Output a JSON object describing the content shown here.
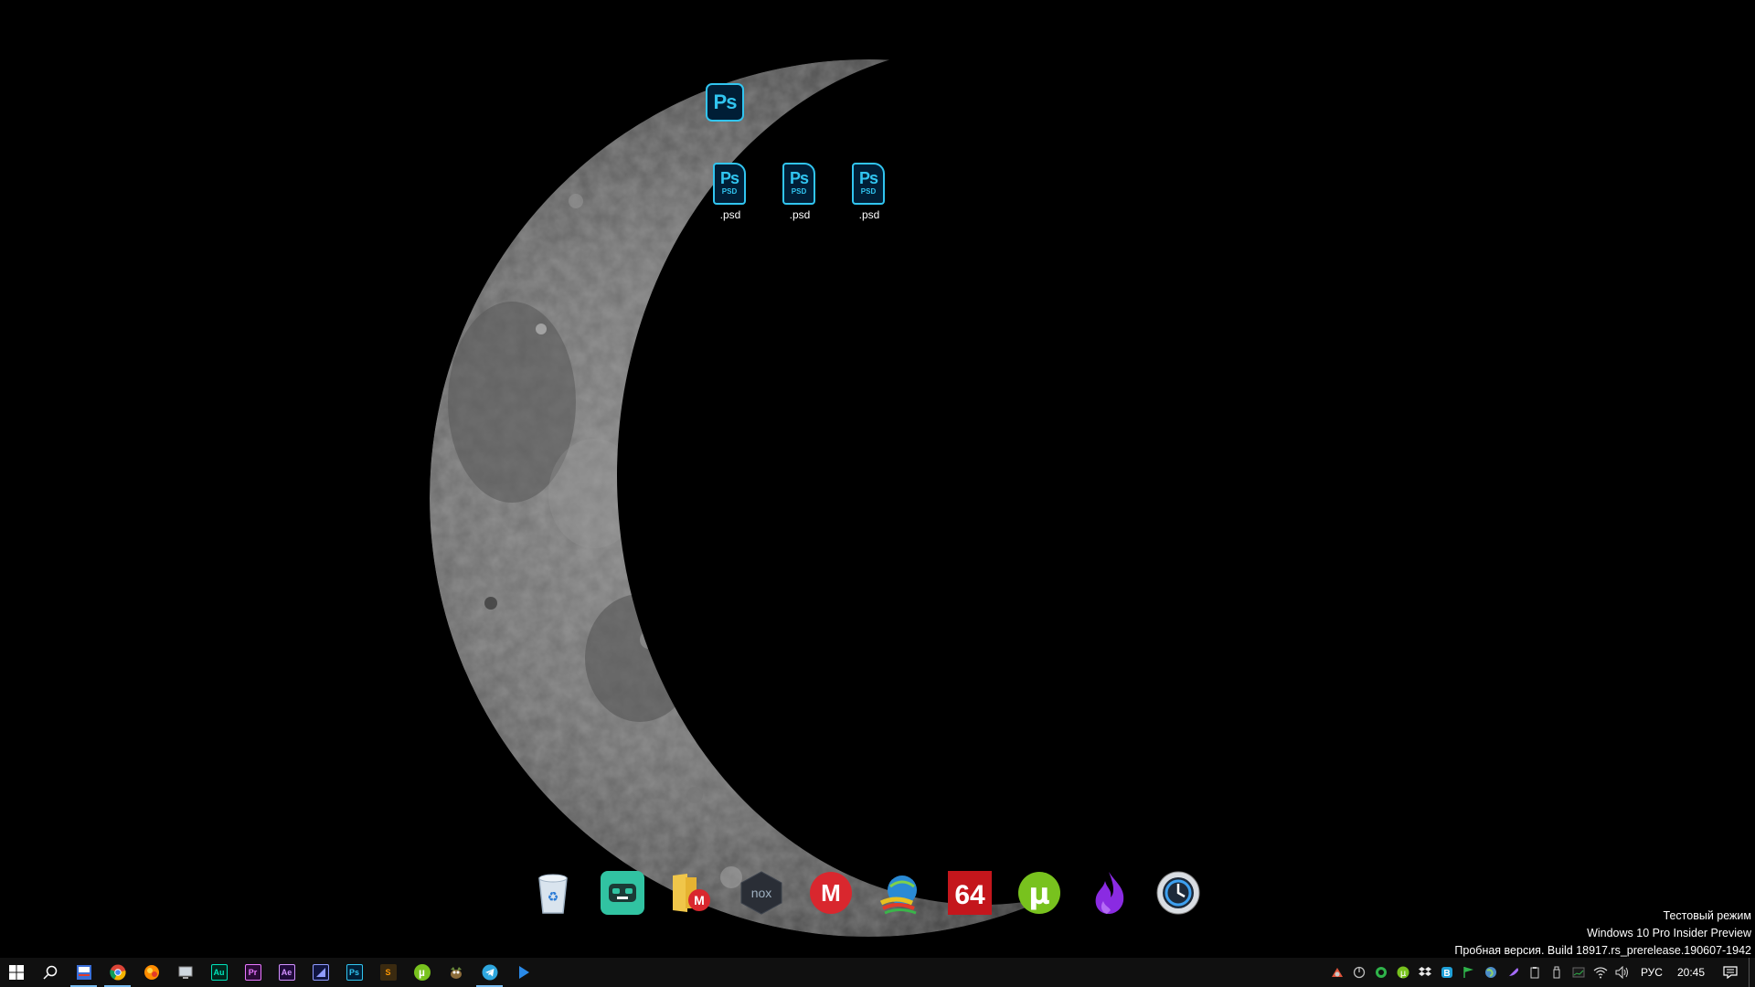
{
  "desktop": {
    "app_icon": {
      "name": "photoshop-app-icon",
      "glyph": "Ps"
    },
    "files": [
      {
        "glyph": "Ps",
        "type": "PSD",
        "label": ".psd"
      },
      {
        "glyph": "Ps",
        "type": "PSD",
        "label": ".psd"
      },
      {
        "glyph": "Ps",
        "type": "PSD",
        "label": ".psd"
      }
    ]
  },
  "dock": {
    "items": [
      {
        "icon": "recycle-bin-icon"
      },
      {
        "icon": "streamlabs-obs-icon"
      },
      {
        "icon": "mega-folder-icon"
      },
      {
        "icon": "nox-player-icon",
        "text": "nox"
      },
      {
        "icon": "mega-icon",
        "text": "M"
      },
      {
        "icon": "internet-download-manager-icon"
      },
      {
        "icon": "aida64-icon",
        "text": "64"
      },
      {
        "icon": "utorrent-icon",
        "text": "µ"
      },
      {
        "icon": "purple-flame-icon"
      },
      {
        "icon": "time-machine-icon"
      }
    ]
  },
  "watermark": {
    "line1": "Тестовый режим",
    "line2": "Windows 10 Pro Insider Preview",
    "line3": "Пробная версия. Build 18917.rs_prerelease.190607-1942"
  },
  "taskbar": {
    "apps": [
      {
        "icon": "start-icon"
      },
      {
        "icon": "search-icon"
      },
      {
        "icon": "files-app-icon",
        "active": true
      },
      {
        "icon": "chrome-icon",
        "active": true
      },
      {
        "icon": "ball-app-icon"
      },
      {
        "icon": "computer-icon"
      },
      {
        "icon": "audition-icon",
        "text": "Au",
        "color": "#00e4bb"
      },
      {
        "icon": "premiere-icon",
        "text": "Pr",
        "color": "#ea77ff"
      },
      {
        "icon": "after-effects-icon",
        "text": "Ae",
        "color": "#d291ff"
      },
      {
        "icon": "media-encoder-icon",
        "text": "",
        "color": "#8f9bff"
      },
      {
        "icon": "photoshop-icon",
        "text": "Ps",
        "color": "#31c5f0"
      },
      {
        "icon": "sublime-icon",
        "text": "S",
        "color": "#ff9800"
      },
      {
        "icon": "utorrent-taskbar-icon",
        "text": "µ",
        "color": "#78c21e"
      },
      {
        "icon": "gimp-icon"
      },
      {
        "icon": "telegram-icon",
        "active": true
      },
      {
        "icon": "play-icon"
      }
    ],
    "tray": {
      "icons": [
        "tray-app-1-icon",
        "tray-power-icon",
        "tray-green-circle-icon",
        "tray-utorrent-icon",
        "tray-dropbox-icon",
        "tray-b-icon",
        "tray-flag-icon",
        "tray-globe-icon",
        "tray-feather-icon",
        "tray-clipboard-icon",
        "tray-usb-icon",
        "tray-monitor-icon",
        "network-icon",
        "volume-icon"
      ],
      "language": "РУС",
      "time": "20:45"
    }
  }
}
